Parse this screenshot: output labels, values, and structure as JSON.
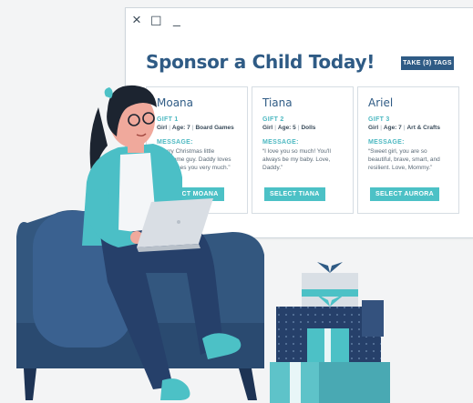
{
  "window": {
    "close_glyph": "×",
    "maximize_glyph": "☐",
    "minimize_glyph": "_"
  },
  "page": {
    "title": "Sponsor a Child Today!",
    "take_tags_label": "TAKE (3) TAGS"
  },
  "cards": [
    {
      "name": "Moana",
      "gift": "GIFT 1",
      "gender": "Girl",
      "age": "Age: 7",
      "interest": "Board Games",
      "message_label": "MESSAGE:",
      "message": "“Merry Christmas little handsome guy. Daddy loves you misses you very much.”",
      "select_label": "SELECT MOANA"
    },
    {
      "name": "Tiana",
      "gift": "GIFT 2",
      "gender": "Girl",
      "age": "Age: 5",
      "interest": "Dolls",
      "message_label": "MESSAGE:",
      "message": "“I love you so much! You'll always be my baby. Love, Daddy.”",
      "select_label": "SELECT TIANA"
    },
    {
      "name": "Ariel",
      "gift": "GIFT 3",
      "gender": "Girl",
      "age": "Age: 7",
      "interest": "Art & Crafts",
      "message_label": "MESSAGE:",
      "message": "“Sweet girl, you are so beautiful, brave, smart, and resilient. Love, Mommy.”",
      "select_label": "SELECT AURORA"
    }
  ],
  "colors": {
    "brand_navy": "#2f5b85",
    "accent_teal": "#4cc1c6",
    "chair_blue": "#33577f",
    "gift_navy": "#26406a"
  },
  "illustration": {
    "person_icon": "woman-with-laptop-illustration",
    "chair_icon": "armchair-illustration",
    "gifts_icon": "gift-stack-illustration"
  }
}
